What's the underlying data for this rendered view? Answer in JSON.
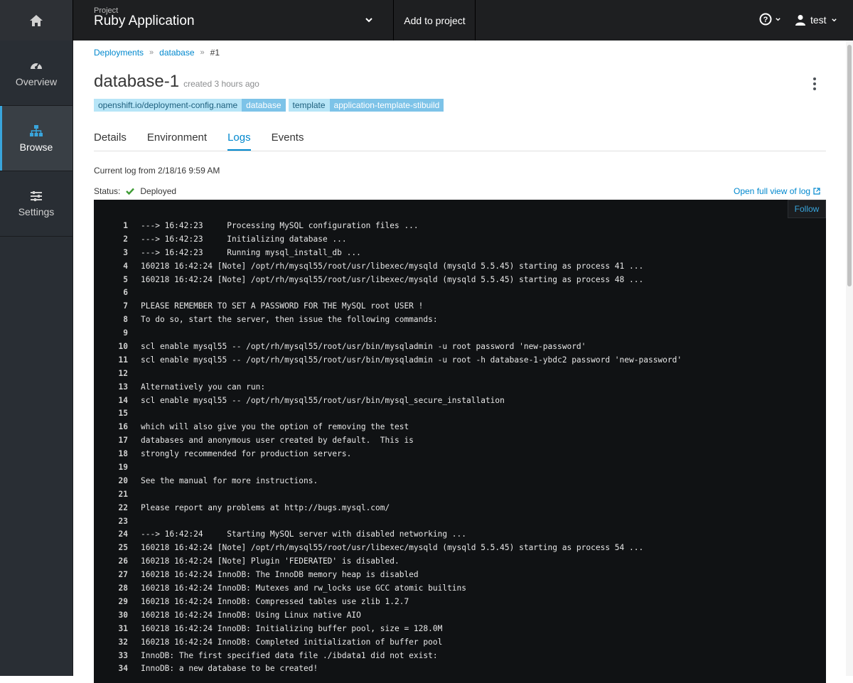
{
  "topbar": {
    "project_label": "Project",
    "project_name": "Ruby Application",
    "add_to_project": "Add to project",
    "user": "test"
  },
  "sidebar": {
    "items": [
      {
        "label": "Overview",
        "icon": "dashboard-icon"
      },
      {
        "label": "Browse",
        "icon": "sitemap-icon"
      },
      {
        "label": "Settings",
        "icon": "sliders-icon"
      }
    ]
  },
  "breadcrumb": [
    "Deployments",
    "database",
    "#1"
  ],
  "page": {
    "title": "database-1",
    "created": "created 3 hours ago",
    "labels": [
      {
        "key": "openshift.io/deployment-config.name",
        "value": "database"
      },
      {
        "key": "template",
        "value": "application-template-stibuild"
      }
    ]
  },
  "tabs": [
    "Details",
    "Environment",
    "Logs",
    "Events"
  ],
  "log": {
    "current": "Current log from 2/18/16 9:59 AM",
    "status_label": "Status:",
    "status_value": "Deployed",
    "full_view": "Open full view of log",
    "follow": "Follow",
    "lines": [
      "---> 16:42:23     Processing MySQL configuration files ...",
      "---> 16:42:23     Initializing database ...",
      "---> 16:42:23     Running mysql_install_db ...",
      "160218 16:42:24 [Note] /opt/rh/mysql55/root/usr/libexec/mysqld (mysqld 5.5.45) starting as process 41 ...",
      "160218 16:42:24 [Note] /opt/rh/mysql55/root/usr/libexec/mysqld (mysqld 5.5.45) starting as process 48 ...",
      "",
      "PLEASE REMEMBER TO SET A PASSWORD FOR THE MySQL root USER !",
      "To do so, start the server, then issue the following commands:",
      "",
      "scl enable mysql55 -- /opt/rh/mysql55/root/usr/bin/mysqladmin -u root password 'new-password'",
      "scl enable mysql55 -- /opt/rh/mysql55/root/usr/bin/mysqladmin -u root -h database-1-ybdc2 password 'new-password'",
      "",
      "Alternatively you can run:",
      "scl enable mysql55 -- /opt/rh/mysql55/root/usr/bin/mysql_secure_installation",
      "",
      "which will also give you the option of removing the test",
      "databases and anonymous user created by default.  This is",
      "strongly recommended for production servers.",
      "",
      "See the manual for more instructions.",
      "",
      "Please report any problems at http://bugs.mysql.com/",
      "",
      "---> 16:42:24     Starting MySQL server with disabled networking ...",
      "160218 16:42:24 [Note] /opt/rh/mysql55/root/usr/libexec/mysqld (mysqld 5.5.45) starting as process 54 ...",
      "160218 16:42:24 [Note] Plugin 'FEDERATED' is disabled.",
      "160218 16:42:24 InnoDB: The InnoDB memory heap is disabled",
      "160218 16:42:24 InnoDB: Mutexes and rw_locks use GCC atomic builtins",
      "160218 16:42:24 InnoDB: Compressed tables use zlib 1.2.7",
      "160218 16:42:24 InnoDB: Using Linux native AIO",
      "160218 16:42:24 InnoDB: Initializing buffer pool, size = 128.0M",
      "160218 16:42:24 InnoDB: Completed initialization of buffer pool",
      "InnoDB: The first specified data file ./ibdata1 did not exist:",
      "InnoDB: a new database to be created!"
    ]
  }
}
